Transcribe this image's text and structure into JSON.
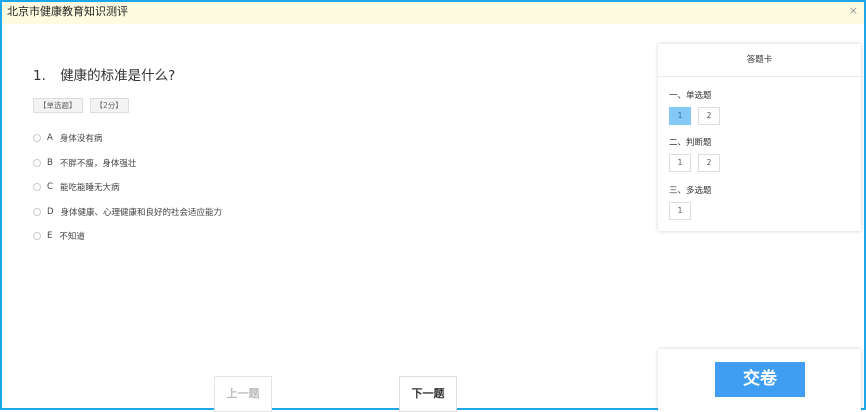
{
  "window": {
    "title": "北京市健康教育知识测评",
    "close_label": "×"
  },
  "question": {
    "number": "1.",
    "text": "健康的标准是什么?",
    "tags": [
      "【单选题】",
      "【2分】"
    ],
    "options": [
      {
        "letter": "A",
        "text": "身体没有病"
      },
      {
        "letter": "B",
        "text": "不胖不瘦，身体强壮"
      },
      {
        "letter": "C",
        "text": "能吃能睡无大病"
      },
      {
        "letter": "D",
        "text": "身体健康、心理健康和良好的社会适应能力"
      },
      {
        "letter": "E",
        "text": "不知道"
      }
    ]
  },
  "answer_card": {
    "title": "答题卡",
    "sections": [
      {
        "label": "一、单选题",
        "items": [
          "1",
          "2"
        ],
        "active": 0
      },
      {
        "label": "二、判断题",
        "items": [
          "1",
          "2"
        ]
      },
      {
        "label": "三、多选题",
        "items": [
          "1"
        ]
      }
    ]
  },
  "nav": {
    "prev_label": "上一题",
    "next_label": "下一题"
  },
  "submit": {
    "label": "交卷"
  },
  "colors": {
    "frame": "#1ea7e8",
    "titlebar_bg": "#fdfbe0",
    "accent": "#3f9df2",
    "active_cell": "#84c8f6"
  }
}
